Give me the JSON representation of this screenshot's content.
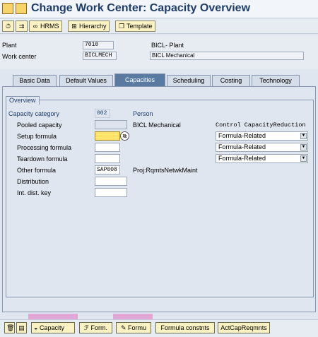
{
  "title": {
    "text": "Change Work Center: Capacity Overview"
  },
  "toolbar": {
    "hrms": "HRMS",
    "hierarchy": "Hierarchy",
    "template": "Template"
  },
  "header": {
    "plant_label": "Plant",
    "plant_value": "7010",
    "plant_desc": "BICL- Plant",
    "wc_label": "Work center",
    "wc_value": "BICLMECH",
    "wc_desc": "BICL Mechanical"
  },
  "tabs": [
    {
      "label": "Basic Data"
    },
    {
      "label": "Default Values"
    },
    {
      "label": "Capacities"
    },
    {
      "label": "Scheduling"
    },
    {
      "label": "Costing"
    },
    {
      "label": "Technology"
    }
  ],
  "overview": {
    "group_title": "Overview",
    "capcat_label": "Capacity category",
    "capcat_value": "002",
    "capcat_desc": "Person",
    "pooled_label": "Pooled capacity",
    "pooled_desc": "BICL Mechanical",
    "setup_label": "Setup formula",
    "processing_label": "Processing formula",
    "teardown_label": "Teardown formula",
    "other_label": "Other formula",
    "other_value": "SAP008",
    "other_desc": "Proj:RqmtsNetwkMaint",
    "distribution_label": "Distribution",
    "intdist_label": "Int. dist. key",
    "control_header": "Control CapacityReduction",
    "dropdown_1": "Formula-Related",
    "dropdown_2": "Formula-Related",
    "dropdown_3": "Formula-Related"
  },
  "bottom": {
    "capacity": "Capacity",
    "form": "Form.",
    "formu": "Formu",
    "constants": "Formula constnts",
    "actcap": "ActCapReqmnts"
  },
  "colors": {
    "highlight": "#e29bd1",
    "active_tab": "#5a7ba1",
    "title_text": "#1f3d6b",
    "focus_field": "#ffe36b"
  }
}
